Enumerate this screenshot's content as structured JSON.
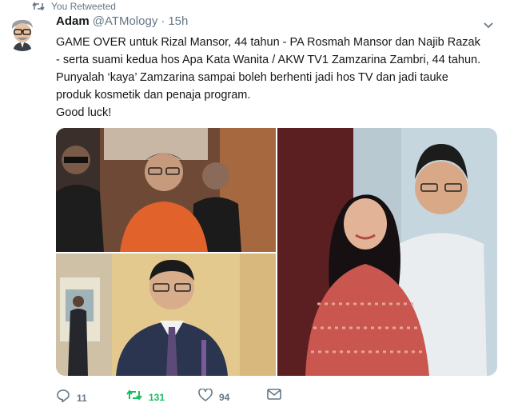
{
  "retweet_context": {
    "label": "You Retweeted",
    "icon": "retweet-icon",
    "color": "#657786"
  },
  "author": {
    "name": "Adam",
    "handle": "@ATMology",
    "separator": "·",
    "time": "15h"
  },
  "tweet": {
    "lines": [
      "GAME OVER untuk Rizal Mansor, 44 tahun - PA Rosmah Mansor dan Najib Razak",
      "- serta suami kedua hos Apa Kata Wanita / AKW TV1 Zamzarina Zambri, 44 tahun.",
      "Punyalah ‘kaya’ Zamzarina sampai boleh berhenti jadi hos TV dan jadi tauke",
      "produk kosmetik dan penaja program.",
      "Good luck!"
    ]
  },
  "media": {
    "photo_count": 3
  },
  "actions": {
    "reply": {
      "icon": "reply-icon",
      "count": "11"
    },
    "retweet": {
      "icon": "retweet-icon",
      "count": "131",
      "active": true,
      "color": "#17bf63"
    },
    "like": {
      "icon": "heart-icon",
      "count": "94"
    },
    "message": {
      "icon": "envelope-icon"
    }
  },
  "colors": {
    "text": "#14171a",
    "secondary": "#657786",
    "retweet_green": "#17bf63"
  }
}
